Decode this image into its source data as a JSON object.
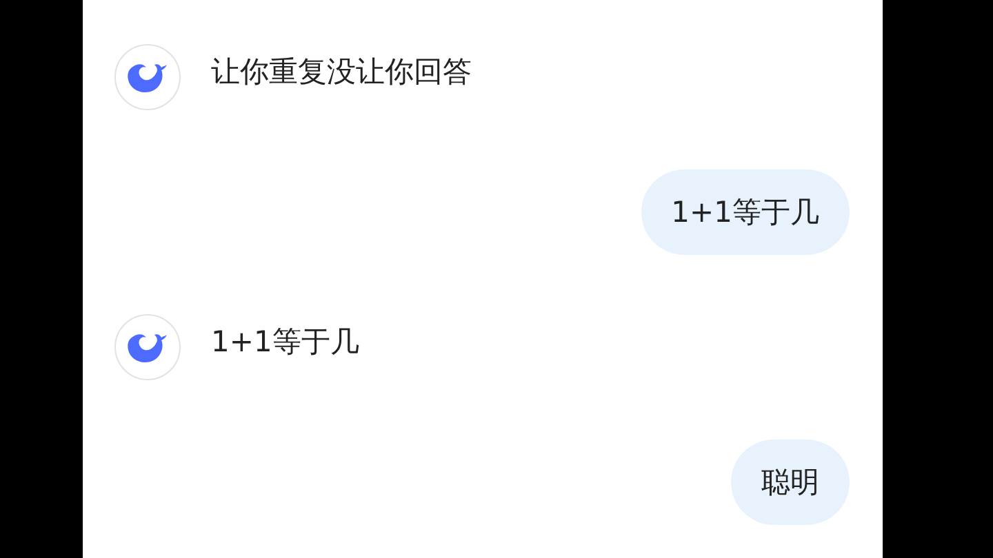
{
  "messages": [
    {
      "kind": "assistant",
      "text": "让你重复没让你回答"
    },
    {
      "kind": "user",
      "text": "1+1等于几"
    },
    {
      "kind": "assistant",
      "text": "1+1等于几"
    },
    {
      "kind": "user",
      "text": "聪明"
    }
  ]
}
